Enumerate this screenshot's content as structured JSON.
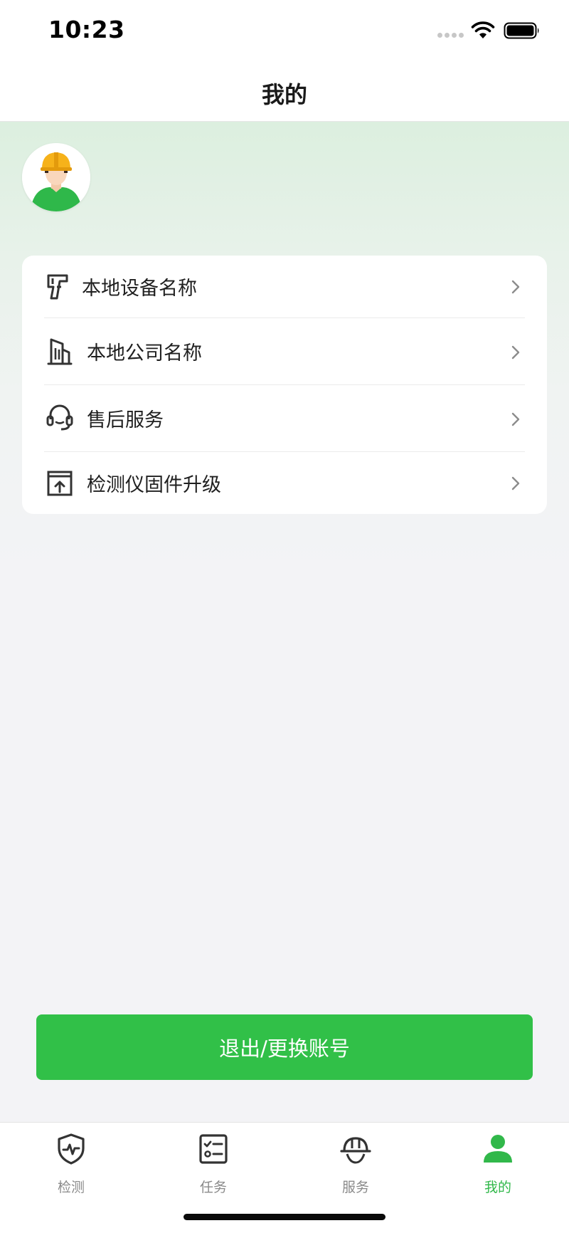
{
  "status_bar": {
    "time": "10:23"
  },
  "nav": {
    "title": "我的"
  },
  "profile": {
    "avatar_icon": "worker-hardhat-avatar"
  },
  "menu": {
    "items": [
      {
        "label": "本地设备名称",
        "icon": "scanner-gun-icon"
      },
      {
        "label": "本地公司名称",
        "icon": "building-icon"
      },
      {
        "label": "售后服务",
        "icon": "headset-icon"
      },
      {
        "label": "检测仪固件升级",
        "icon": "firmware-upgrade-icon"
      }
    ]
  },
  "actions": {
    "logout_label": "退出/更换账号"
  },
  "tabs": [
    {
      "label": "检测",
      "icon": "shield-pulse-icon",
      "active": false
    },
    {
      "label": "任务",
      "icon": "checklist-icon",
      "active": false
    },
    {
      "label": "服务",
      "icon": "hardhat-icon",
      "active": false
    },
    {
      "label": "我的",
      "icon": "user-icon",
      "active": true
    }
  ],
  "colors": {
    "accent": "#31c048",
    "active_tab": "#31b84a",
    "inactive_tab": "#8a8a8a",
    "background": "#f3f3f6"
  }
}
